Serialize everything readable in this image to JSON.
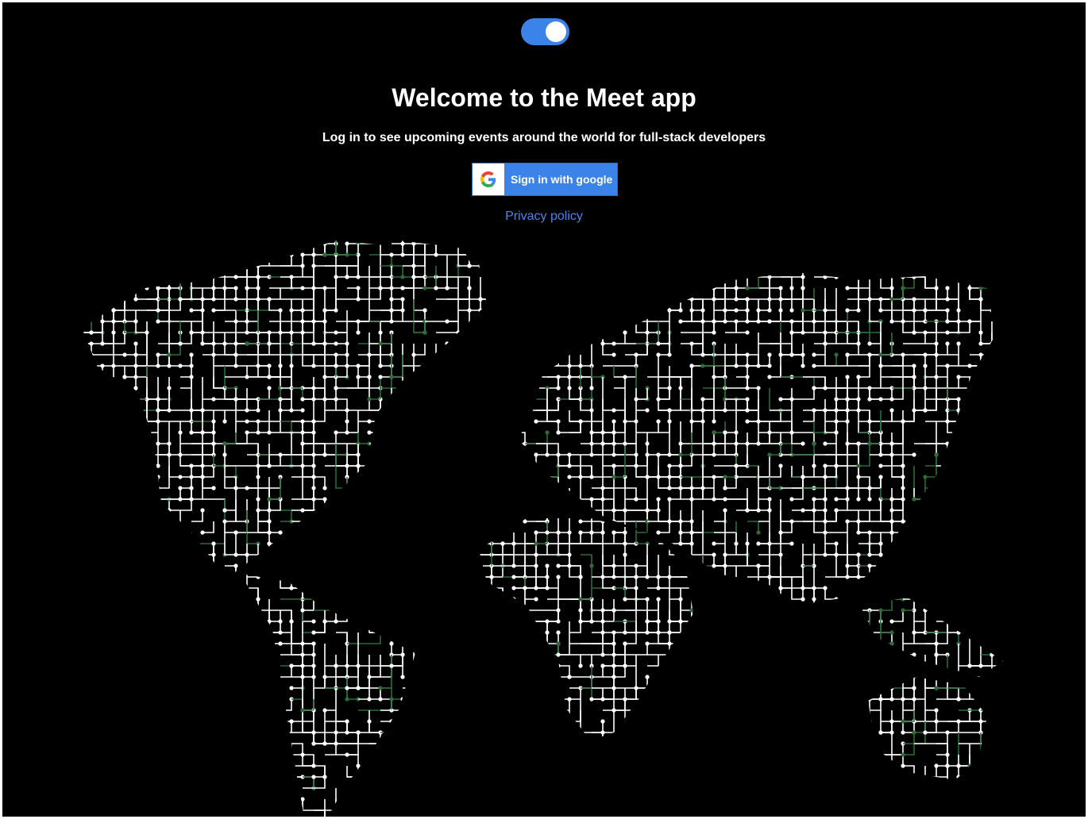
{
  "header": {
    "toggle_label": "theme-toggle",
    "toggle_on": true
  },
  "main": {
    "title": "Welcome to the Meet app",
    "subtitle": "Log in to see upcoming events around the world for full-stack developers",
    "signin_label": "Sign in with google",
    "privacy_label": "Privacy policy"
  },
  "colors": {
    "background": "#000000",
    "accent": "#3b83e8",
    "link": "#4a86e8",
    "circuit_white": "#ffffff",
    "circuit_green": "#2e6b3a"
  },
  "icons": {
    "google": "google-g-logo",
    "map": "world-map-circuit"
  }
}
